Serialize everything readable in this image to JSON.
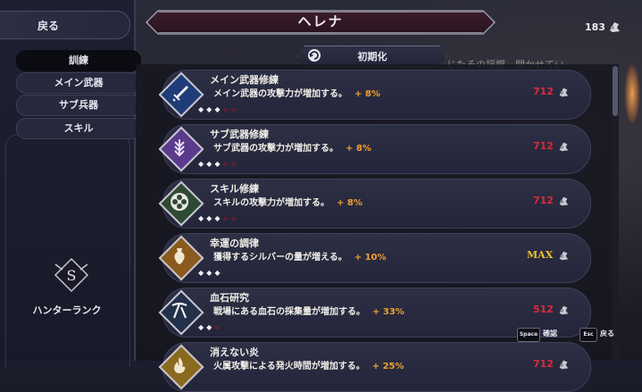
{
  "header": {
    "title": "ヘレナ",
    "reset_label": "初期化",
    "currency_value": "183"
  },
  "background": {
    "sign_text": "じたその揺擲．開かせてい"
  },
  "sidebar": {
    "back_label": "戻る",
    "tabs": [
      {
        "label": "訓練",
        "active": true
      },
      {
        "label": "メイン武器",
        "active": false
      },
      {
        "label": "サブ兵器",
        "active": false
      },
      {
        "label": "スキル",
        "active": false
      }
    ],
    "rank_letter": "S",
    "rank_label": "ハンターランク"
  },
  "rows": [
    {
      "name": "メイン武器修練",
      "desc": "メイン武器の攻撃力が増加する。",
      "bonus": "+ 8%",
      "cost": "712",
      "pips_filled": 3,
      "pips_total": 5,
      "icon": "sword-icon",
      "icon_color": "#1e3c78"
    },
    {
      "name": "サブ武器修練",
      "desc": "サブ武器の攻撃力が増加する。",
      "bonus": "+ 8%",
      "cost": "712",
      "pips_filled": 3,
      "pips_total": 5,
      "icon": "daggers-icon",
      "icon_color": "#5a3a8a"
    },
    {
      "name": "スキル修練",
      "desc": "スキルの攻撃力が増加する。",
      "bonus": "+ 8%",
      "cost": "712",
      "pips_filled": 3,
      "pips_total": 5,
      "icon": "flower-icon",
      "icon_color": "#2e4a34"
    },
    {
      "name": "幸運の調律",
      "desc": "獲得するシルバーの量が増える。",
      "bonus": "+ 10%",
      "cost": "MAX",
      "pips_filled": 3,
      "pips_total": 3,
      "icon": "vase-icon",
      "icon_color": "#8a5a1e"
    },
    {
      "name": "血石研究",
      "desc": "戦場にある血石の採集量が増加する。",
      "bonus": "+ 33%",
      "cost": "512",
      "pips_filled": 2,
      "pips_total": 3,
      "icon": "pickaxe-icon",
      "icon_color": "#22304a"
    },
    {
      "name": "消えない炎",
      "desc": "火属攻撃による発火時間が増加する。",
      "bonus": "+ 25%",
      "cost": "712",
      "pips_filled": 0,
      "pips_total": 0,
      "icon": "flame-icon",
      "icon_color": "#8a6a1e"
    }
  ],
  "prompts": {
    "confirm_key": "Space",
    "confirm_label": "確認",
    "back_key": "Esc",
    "back_label": "戻る"
  },
  "colors": {
    "bonus": "#f0a030",
    "cost": "#e02838",
    "max": "#e8c030"
  }
}
